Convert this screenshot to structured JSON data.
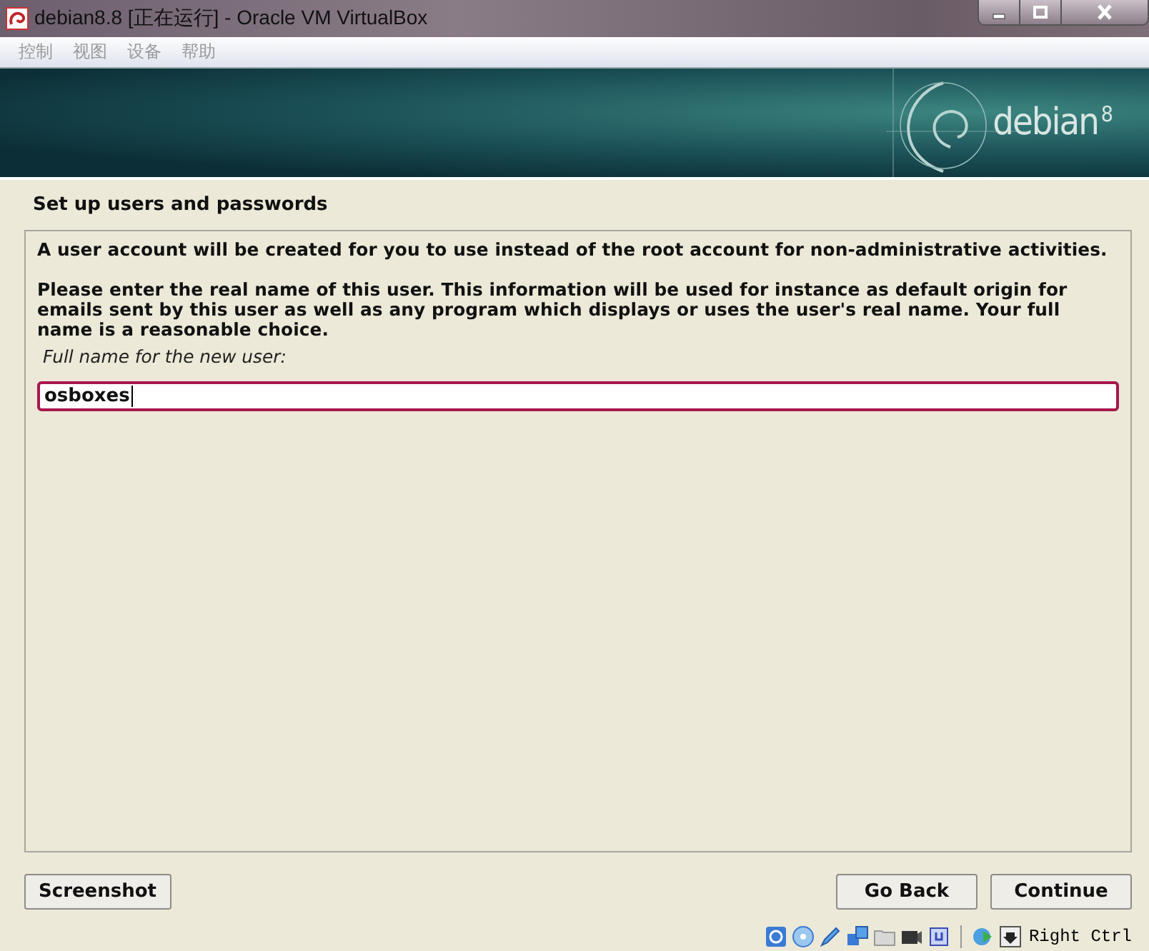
{
  "window": {
    "title": "debian8.8 [正在运行] - Oracle VM VirtualBox"
  },
  "menu": [
    {
      "label": "控制",
      "disabled": true
    },
    {
      "label": "视图",
      "disabled": true
    },
    {
      "label": "设备",
      "disabled": true
    },
    {
      "label": "帮助",
      "disabled": true
    }
  ],
  "banner": {
    "logo": "debian",
    "version": "8"
  },
  "installer": {
    "heading": "Set up users and passwords",
    "paragraphs": [
      "A user account will be created for you to use instead of the root account for non-administrative activities.",
      "Please enter the real name of this user. This information will be used for instance as default origin for emails sent by this user as well as any program which displays or uses the user's real name. Your full name is a reasonable choice."
    ],
    "field_label": "Full name for the new user:",
    "field_value": "osboxes",
    "buttons": [
      {
        "label": "Screenshot",
        "kind": "left"
      },
      {
        "label": "Go Back",
        "kind": "right"
      },
      {
        "label": "Continue",
        "kind": "right"
      }
    ]
  },
  "status_bar": {
    "host_key": "Right Ctrl"
  }
}
